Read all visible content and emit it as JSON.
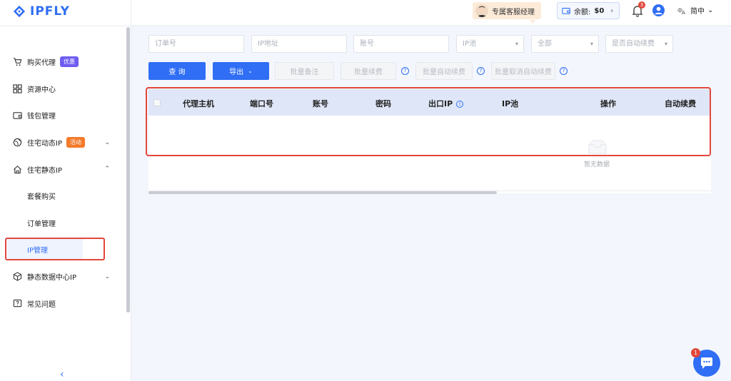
{
  "brand": {
    "name": "IPFLY",
    "color": "#2f6ef5"
  },
  "header": {
    "manager_label": "专属客服经理",
    "balance_label": "余额:",
    "balance_value": "$0",
    "notification_count": "3",
    "language": "简中"
  },
  "sidebar": {
    "items": [
      {
        "label": "购买代理",
        "icon": "cart-icon",
        "badge": "优惠"
      },
      {
        "label": "资源中心",
        "icon": "grid-icon"
      },
      {
        "label": "钱包管理",
        "icon": "wallet-icon"
      },
      {
        "label": "住宅动态IP",
        "icon": "globe-icon",
        "badge": "活动"
      },
      {
        "label": "住宅静态IP",
        "icon": "home-icon"
      },
      {
        "label": "静态数据中心IP",
        "icon": "cube-icon"
      },
      {
        "label": "常见问题",
        "icon": "question-icon"
      }
    ],
    "sub_items": [
      "套餐购买",
      "订单管理",
      "IP管理"
    ]
  },
  "filters": {
    "order_no": "订单号",
    "ip_address": "IP地址",
    "account": "账号",
    "ip_pool": "IP池",
    "status": "全部",
    "auto_renew": "是否自动续费"
  },
  "actions": {
    "query": "查 询",
    "export": "导出",
    "batch_note": "批量备注",
    "batch_renew": "批量续费",
    "batch_auto_renew": "批量自动续费",
    "batch_cancel_auto_renew": "批量取消自动续费"
  },
  "table": {
    "columns": [
      "代理主机",
      "端口号",
      "账号",
      "密码",
      "出口IP",
      "IP池",
      "操作",
      "自动续费"
    ],
    "empty_text": "暂无数据"
  },
  "chat": {
    "unread": "1"
  },
  "colors": {
    "accent": "#2f6ef5",
    "highlight": "#e2473b",
    "badge_purple": "#6e5df0",
    "badge_orange": "#f47a2a"
  }
}
